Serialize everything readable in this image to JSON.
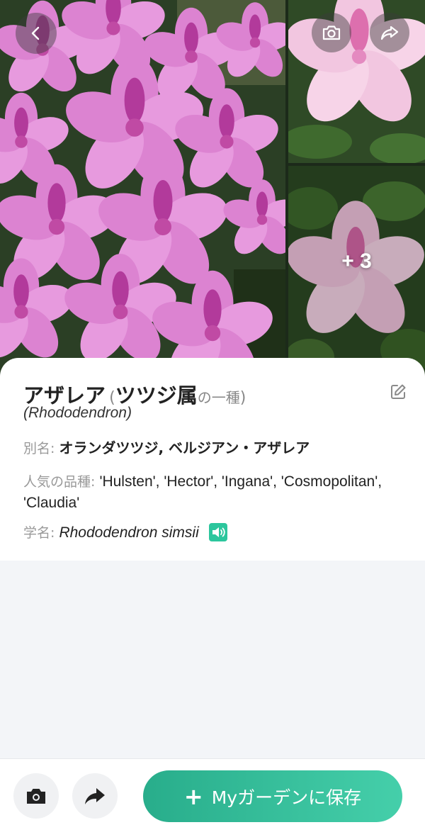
{
  "gallery": {
    "more_count": "+ 3",
    "icons": {
      "back": "chevron-left-icon",
      "camera": "camera-icon",
      "share": "share-arrow-icon"
    }
  },
  "plant": {
    "common_name": "アザレア",
    "paren_open": "(",
    "genus_japanese": "ツツジ属",
    "genus_suffix": "の一種",
    "paren_close": ")",
    "genus_latin": "(Rhododendron)",
    "alias_label": "別名: ",
    "alias_value": "オランダツツジ, ベルジアン・アザレア",
    "cultivars_label": "人気の品種: ",
    "cultivars_value": "'Hulsten', 'Hector', 'Ingana', 'Cosmopolitan', 'Claudia'",
    "scientific_label": "学名: ",
    "scientific_value": "Rhododendron simsii"
  },
  "bottom_bar": {
    "save_plus": "+",
    "save_label": "Myガーデンに保存"
  },
  "colors": {
    "accent": "#2cc69d",
    "button_gradient_start": "#28ad8b",
    "button_gradient_end": "#45cfaa",
    "flower_pink": "#d877c9"
  }
}
